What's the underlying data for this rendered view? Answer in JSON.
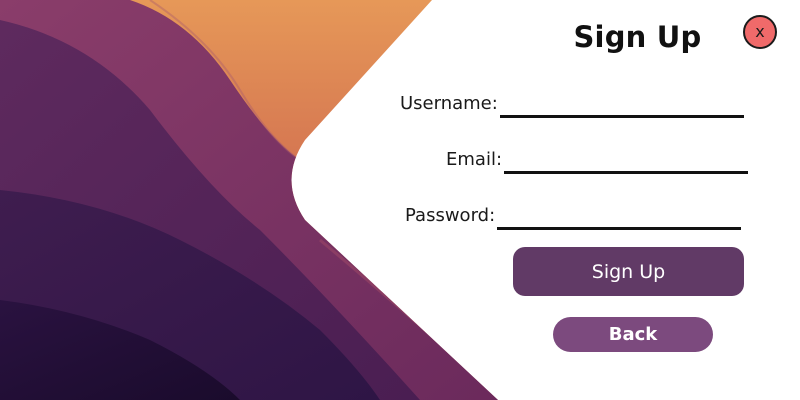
{
  "window": {
    "title": "Sign Up",
    "close_label": "x"
  },
  "form": {
    "username_label": "Username:",
    "email_label": "Email:",
    "password_label": "Password:",
    "username_value": "",
    "email_value": "",
    "password_value": ""
  },
  "buttons": {
    "signup_label": "Sign Up",
    "back_label": "Back"
  },
  "colors": {
    "close_button": "#f06a6a",
    "signup_button": "#613a66",
    "back_button": "#7c4a7e",
    "wallpaper_orange": "#e48a57",
    "wallpaper_purple": "#2a1546"
  }
}
